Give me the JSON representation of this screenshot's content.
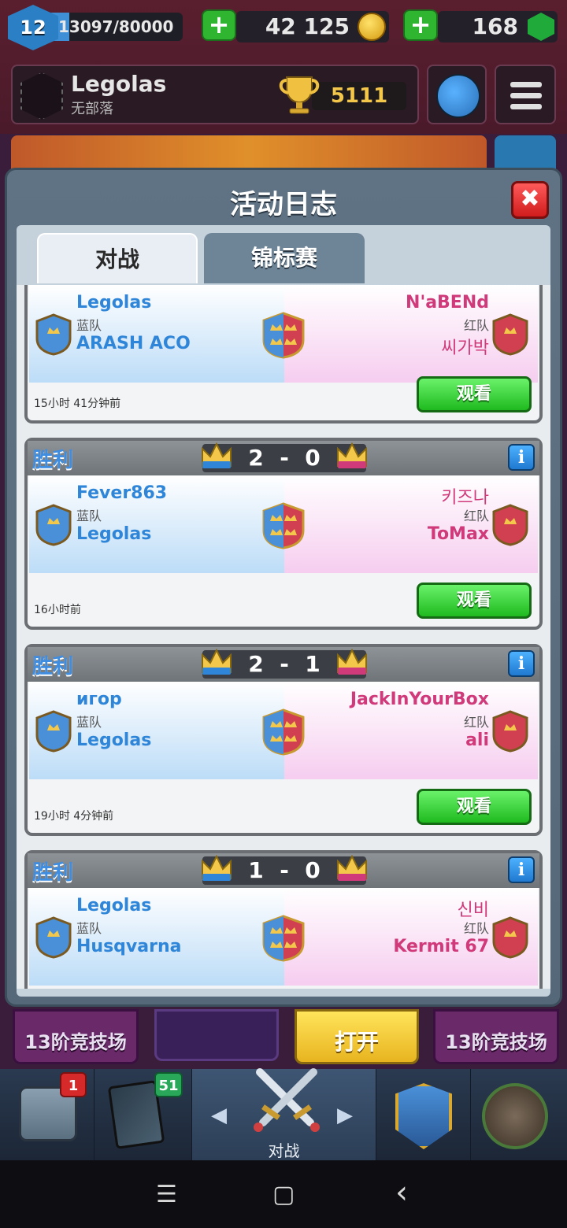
{
  "topbar": {
    "level": "12",
    "xp": "13097/80000",
    "xp_progress": 0.164,
    "gold": "42 125",
    "gems": "168"
  },
  "profile": {
    "name": "Legolas",
    "clan": "无部落",
    "trophies": "5111"
  },
  "modal": {
    "title": "活动日志",
    "close_label": "✖",
    "tabs": [
      {
        "label": "对战",
        "active": true
      },
      {
        "label": "锦标赛",
        "active": false
      }
    ]
  },
  "battles": [
    {
      "result": "",
      "score_blue": "",
      "score_red": "",
      "blue_player": "Legolas",
      "blue_team_label": "蓝队",
      "blue_partner": "ARASH ACO",
      "red_player": "N'aBENd",
      "red_team_label": "红队",
      "red_partner": "씨가박",
      "time": "15小时 41分钟前",
      "watch_label": "观看"
    },
    {
      "result": "胜利",
      "score_blue": "2",
      "score_red": "0",
      "blue_player": "Fever863",
      "blue_team_label": "蓝队",
      "blue_partner": "Legolas",
      "red_player": "키즈나",
      "red_team_label": "红队",
      "red_partner": "ToMax",
      "time": "16小时前",
      "watch_label": "观看"
    },
    {
      "result": "胜利",
      "score_blue": "2",
      "score_red": "1",
      "blue_player": "игор",
      "blue_team_label": "蓝队",
      "blue_partner": "Legolas",
      "red_player": "JackInYourBox",
      "red_team_label": "红队",
      "red_partner": "ali",
      "time": "19小时 4分钟前",
      "watch_label": "观看"
    },
    {
      "result": "胜利",
      "score_blue": "1",
      "score_red": "0",
      "blue_player": "Legolas",
      "blue_team_label": "蓝队",
      "blue_partner": "Husqvarna",
      "red_player": "신비",
      "red_team_label": "红队",
      "red_partner": "Kermit 67",
      "time": "",
      "watch_label": ""
    }
  ],
  "lower_buttons": {
    "arena_left": "13阶竞技场",
    "open": "打开",
    "arena_right": "13阶竞技场"
  },
  "bottom_nav": {
    "chest_badge": "1",
    "cards_badge": "51",
    "battle_label": "对战",
    "left_arrow": "◀",
    "right_arrow": "▶"
  },
  "system_nav": {
    "menu": "☰",
    "home": "▢",
    "back": "‹"
  },
  "colors": {
    "blue_team": "#2f86d8",
    "red_team": "#d03a7a",
    "watch_button": "#1fba1f",
    "win_text": "#3f8de0"
  }
}
